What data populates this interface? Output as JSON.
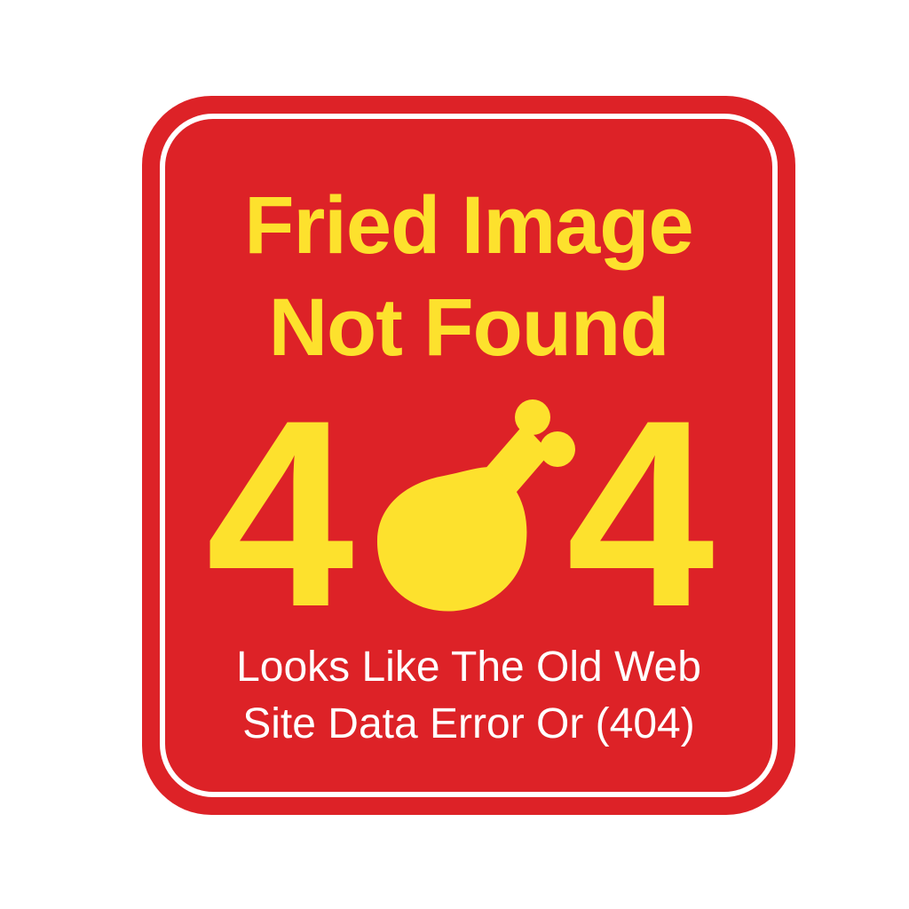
{
  "sign": {
    "title_line_1": "Fried Image",
    "title_line_2": "Not Found",
    "code_digit_left": "4",
    "code_digit_right": "4",
    "subtitle_line_1": "Looks Like The Old Web",
    "subtitle_line_2": "Site Data Error Or (404)",
    "icon": "chicken-drumstick-icon"
  },
  "colors": {
    "background": "#ffffff",
    "sign_red": "#dd2227",
    "accent_yellow": "#fde12d",
    "text_white": "#ffffff"
  }
}
